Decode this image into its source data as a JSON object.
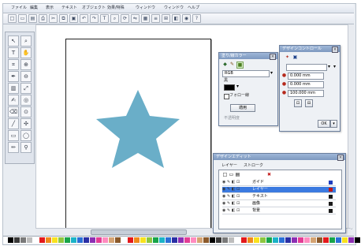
{
  "menubar": {
    "items": [
      "ファイル",
      "編集",
      "表示",
      "テキスト",
      "オブジェクト",
      "効果/特殊",
      "ウィンドウ",
      "ウィンドウ",
      "ヘルプ"
    ]
  },
  "toolbar": {
    "icons": [
      "new-icon",
      "open-icon",
      "save-icon",
      "print-icon",
      "cut-icon",
      "copy-icon",
      "paste-icon",
      "undo-icon",
      "redo-icon",
      "text-icon",
      "zoom-icon",
      "rotate-icon",
      "flip-icon",
      "group-icon",
      "align-icon",
      "grid-icon",
      "layer-icon",
      "color-icon",
      "help-icon"
    ]
  },
  "toolbox": {
    "tools": [
      "selection-tool",
      "zoom-tool",
      "text-tool",
      "hand-tool",
      "crop-tool",
      "zoom-in-tool",
      "pen-tool",
      "zoom-out-tool",
      "fill-tool",
      "scale-tool",
      "brush-tool",
      "view-tool",
      "eraser-tool",
      "magnify-tool",
      "line-tool",
      "pan-tool",
      "rect-tool",
      "ellipse-tool",
      "pencil-tool",
      "eyedropper-tool"
    ]
  },
  "color_panel": {
    "title": "塗り/線カラー",
    "mode": "RGB",
    "label_black": "黒",
    "opacity_label": "不透明度",
    "apply_label": "適用",
    "checkbox_label": "フォロー線"
  },
  "transform_panel": {
    "title": "デザインコントロール",
    "x_value": "0.000 mm",
    "y_value": "0.000 mm",
    "w_value": "100.000 mm",
    "ok_label": "OK"
  },
  "layer_panel": {
    "title": "デザインエディット",
    "tab_label": "レイヤー",
    "tab_label2": "ストローク",
    "layers": [
      {
        "name": "ガイド",
        "color": "#1f3fbf"
      },
      {
        "name": "レイヤー",
        "color": "#c21818"
      },
      {
        "name": "テキスト",
        "color": "#1b1b1b"
      },
      {
        "name": "画像",
        "color": "#1b1b1b"
      },
      {
        "name": "背景",
        "color": "#1b1b1b"
      }
    ]
  },
  "canvas": {
    "star_color": "#6aaec8"
  },
  "palette": {
    "colors": [
      "#000000",
      "#3a3a3a",
      "#7a7a7a",
      "#bdbdbd",
      "#ffffff",
      "#e3191c",
      "#f08a1c",
      "#f8e21e",
      "#8dc63f",
      "#18a44a",
      "#1bb3c7",
      "#2a6fd6",
      "#2a2fa5",
      "#8c2fb3",
      "#e33d95",
      "#ff8bbf",
      "#d4a373",
      "#8b5a2b",
      "#ffffff",
      "#e3191c",
      "#f08a1c",
      "#f8e21e",
      "#8dc63f",
      "#18a44a",
      "#1bb3c7",
      "#2a6fd6",
      "#2a2fa5",
      "#8c2fb3",
      "#e33d95",
      "#ff8bbf",
      "#d4a373",
      "#8b5a2b",
      "#000000",
      "#3a3a3a",
      "#7a7a7a",
      "#bdbdbd",
      "#ffffff",
      "#e3191c",
      "#f08a1c",
      "#f8e21e",
      "#8dc63f",
      "#18a44a",
      "#1bb3c7",
      "#2a6fd6",
      "#2a2fa5",
      "#8c2fb3",
      "#e33d95",
      "#ff8bbf",
      "#d4a373",
      "#8b5a2b",
      "#e3191c",
      "#18a44a",
      "#2a6fd6",
      "#f8e21e",
      "#8c2fb3",
      "#000000"
    ]
  }
}
